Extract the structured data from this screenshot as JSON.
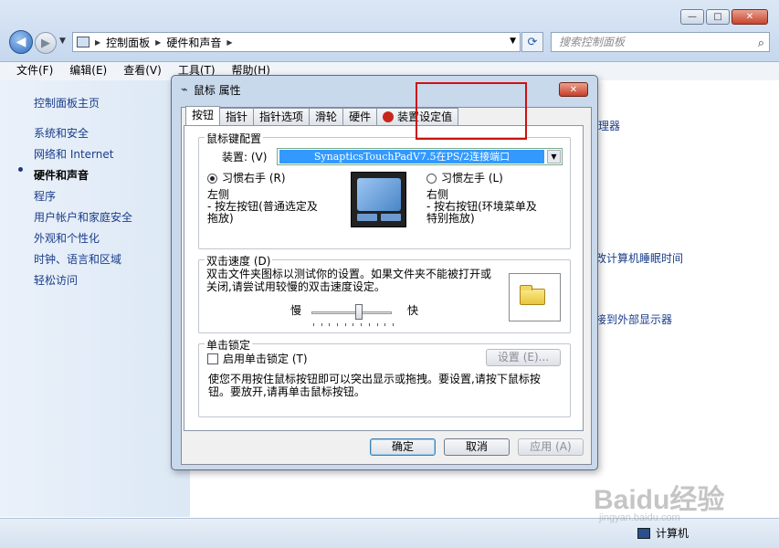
{
  "window": {
    "breadcrumb": [
      "控制面板",
      "硬件和声音"
    ],
    "search_placeholder": "搜索控制面板",
    "controls": {
      "minimize": "—",
      "maximize": "□",
      "close": "✕"
    }
  },
  "menu": [
    "文件(F)",
    "编辑(E)",
    "查看(V)",
    "工具(T)",
    "帮助(H)"
  ],
  "sidebar": {
    "items": [
      {
        "label": "控制面板主页"
      },
      {
        "label": "系统和安全"
      },
      {
        "label": "网络和 Internet"
      },
      {
        "label": "硬件和声音",
        "active": true
      },
      {
        "label": "程序"
      },
      {
        "label": "用户帐户和家庭安全"
      },
      {
        "label": "外观和个性化"
      },
      {
        "label": "时钟、语言和区域"
      },
      {
        "label": "轻松访问"
      }
    ]
  },
  "background_links": [
    "理器",
    "改计算机睡眠时间",
    "接到外部显示器"
  ],
  "status": {
    "computer": "计算机"
  },
  "dialog": {
    "title": "鼠标 属性",
    "tabs": [
      "按钮",
      "指针",
      "指针选项",
      "滑轮",
      "硬件",
      "装置设定值"
    ],
    "mouse_config": {
      "group_label": "鼠标键配置",
      "device_label": "装置: (V)",
      "device_value": "SynapticsTouchPadV7.5在PS/2连接端口",
      "right_hand": "习惯右手 (R)",
      "left_hand": "习惯左手 (L)",
      "left_title": "左侧",
      "left_desc_1": " - 按左按钮(普通选定及",
      "left_desc_2": "拖放)",
      "right_title": "右侧",
      "right_desc_1": " - 按右按钮(环境菜单及",
      "right_desc_2": "特别拖放)"
    },
    "double_click": {
      "group_label": "双击速度 (D)",
      "desc_1": "双击文件夹图标以测试你的设置。如果文件夹不能被打开或",
      "desc_2": "关闭,请尝试用较慢的双击速度设定。",
      "slow": "慢",
      "fast": "快",
      "speed_level": 0.6
    },
    "click_lock": {
      "group_label": "单击锁定",
      "checkbox_label": "启用单击锁定 (T)",
      "settings_button": "设置 (E)...",
      "desc_1": "使您不用按住鼠标按钮即可以突出显示或拖拽。要设置,请按下鼠标按",
      "desc_2": "钮。要放开,请再单击鼠标按钮。"
    },
    "buttons": {
      "ok": "确定",
      "cancel": "取消",
      "apply": "应用 (A)"
    }
  },
  "watermark": {
    "brand": "Baidu经验",
    "url": "jingyan.baidu.com"
  }
}
